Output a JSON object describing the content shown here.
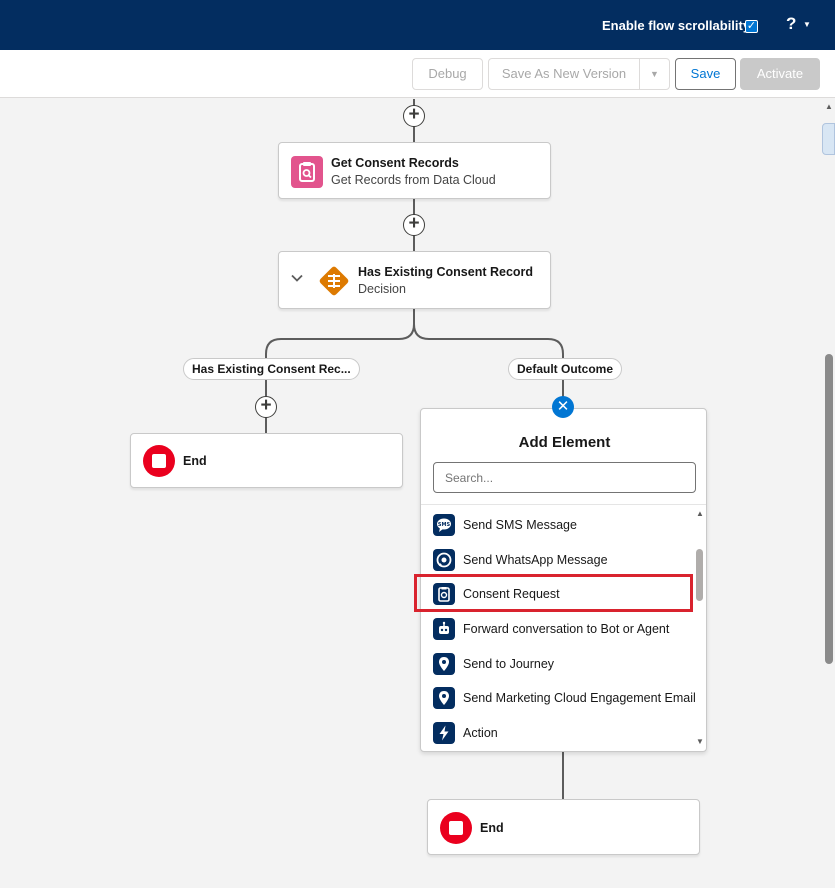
{
  "header": {
    "scroll_label": "Enable flow scrollability",
    "checkbox_mark": "✓",
    "help": "?",
    "help_caret": "▼"
  },
  "toolbar": {
    "debug": "Debug",
    "save_as_new_version": "Save As New Version",
    "save_as_caret": "▼",
    "save": "Save",
    "activate": "Activate"
  },
  "flow": {
    "get_records": {
      "title": "Get Consent Records",
      "subtitle": "Get Records from Data Cloud"
    },
    "decision": {
      "title": "Has Existing Consent Record",
      "subtitle": "Decision"
    },
    "outcome_left": "Has Existing Consent Rec...",
    "outcome_right": "Default Outcome",
    "end_left": "End",
    "end_bottom": "End",
    "plus": "+",
    "close": "✕"
  },
  "add_element": {
    "title": "Add Element",
    "search_placeholder": "Search...",
    "items": [
      {
        "label": "Send SMS Message",
        "icon": "sms-icon"
      },
      {
        "label": "Send WhatsApp Message",
        "icon": "whatsapp-icon"
      },
      {
        "label": "Consent Request",
        "icon": "consent-icon"
      },
      {
        "label": "Forward conversation to Bot or Agent",
        "icon": "bot-icon"
      },
      {
        "label": "Send to Journey",
        "icon": "location-pin-icon"
      },
      {
        "label": "Send Marketing Cloud Engagement Email",
        "icon": "location-pin-icon"
      },
      {
        "label": "Action",
        "icon": "lightning-icon"
      }
    ],
    "scroll_up": "▲",
    "scroll_down": "▼"
  },
  "colors": {
    "header_bg": "#032d60",
    "brand_blue": "#0176d3",
    "get_records_pink": "#e2548d",
    "decision_orange": "#dd7a01",
    "end_red": "#ea001e",
    "highlight_red": "#d9232e"
  }
}
